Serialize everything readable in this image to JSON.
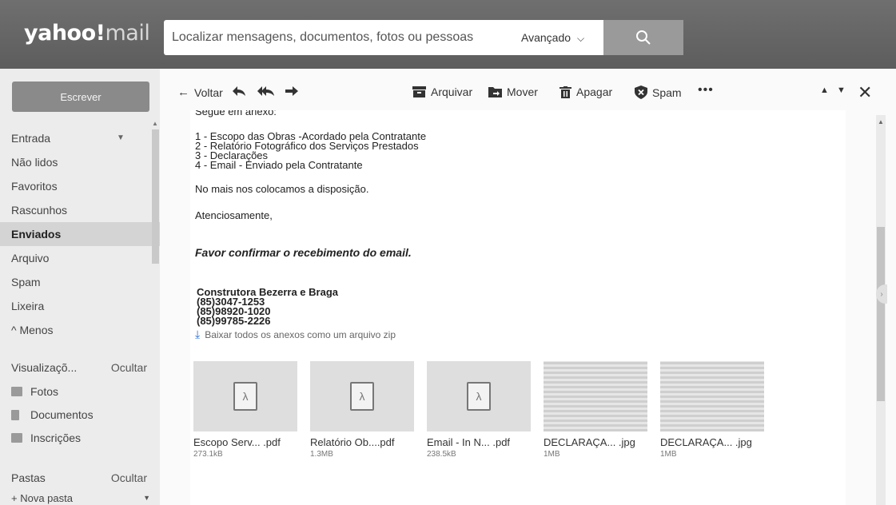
{
  "header": {
    "logo_brand": "yahoo!",
    "logo_product": "mail",
    "search_placeholder": "Localizar mensagens, documentos, fotos ou pessoas",
    "advanced_label": "Avançado"
  },
  "sidebar": {
    "compose_label": "Escrever",
    "folders": [
      {
        "label": "Entrada"
      },
      {
        "label": "Não lidos"
      },
      {
        "label": "Favoritos"
      },
      {
        "label": "Rascunhos"
      },
      {
        "label": "Enviados"
      },
      {
        "label": "Arquivo"
      },
      {
        "label": "Spam"
      },
      {
        "label": "Lixeira"
      },
      {
        "label": "^ Menos"
      }
    ],
    "views_title": "Visualizaçõ...",
    "views_hide": "Ocultar",
    "views": [
      "Fotos",
      "Documentos",
      "Inscrições"
    ],
    "folders_title": "Pastas",
    "folders_hide": "Ocultar",
    "new_folder": "+ Nova pasta"
  },
  "toolbar": {
    "back": "Voltar",
    "archive": "Arquivar",
    "move": "Mover",
    "delete": "Apagar",
    "spam": "Spam",
    "more": "•••"
  },
  "message": {
    "cut_line": "Segue em anexo:",
    "items": [
      "1 - Escopo das Obras -Acordado pela Contratante",
      "2 - Relatório Fotográfico dos Serviços Prestados",
      "3 - Declarações",
      "4 - Email - Enviado pela Contratante"
    ],
    "closing1": "No mais nos colocamos a disposição.",
    "closing2": "Atenciosamente,",
    "confirm": "Favor confirmar o recebimento do email.",
    "sig_company": "Construtora Bezerra e Braga",
    "sig_phones": [
      "(85)3047-1253",
      "(85)98920-1020",
      "(85)99785-2226"
    ],
    "zip_link": "Baixar todos os anexos como um arquivo zip"
  },
  "attachments": [
    {
      "name": "Escopo Serv... .pdf",
      "size": "273.1kB",
      "type": "pdf"
    },
    {
      "name": "Relatório Ob....pdf",
      "size": "1.3MB",
      "type": "pdf"
    },
    {
      "name": "Email - In N... .pdf",
      "size": "238.5kB",
      "type": "pdf"
    },
    {
      "name": "DECLARAÇA... .jpg",
      "size": "1MB",
      "type": "image"
    },
    {
      "name": "DECLARAÇA... .jpg",
      "size": "1MB",
      "type": "image"
    }
  ],
  "icons": [
    "search-icon",
    "chevron-down-icon",
    "back-arrow-icon",
    "reply-icon",
    "reply-all-icon",
    "forward-icon",
    "archive-icon",
    "move-icon",
    "trash-icon",
    "spam-shield-icon",
    "more-icon",
    "prev-message-icon",
    "next-message-icon",
    "close-icon",
    "download-icon",
    "pdf-icon"
  ]
}
